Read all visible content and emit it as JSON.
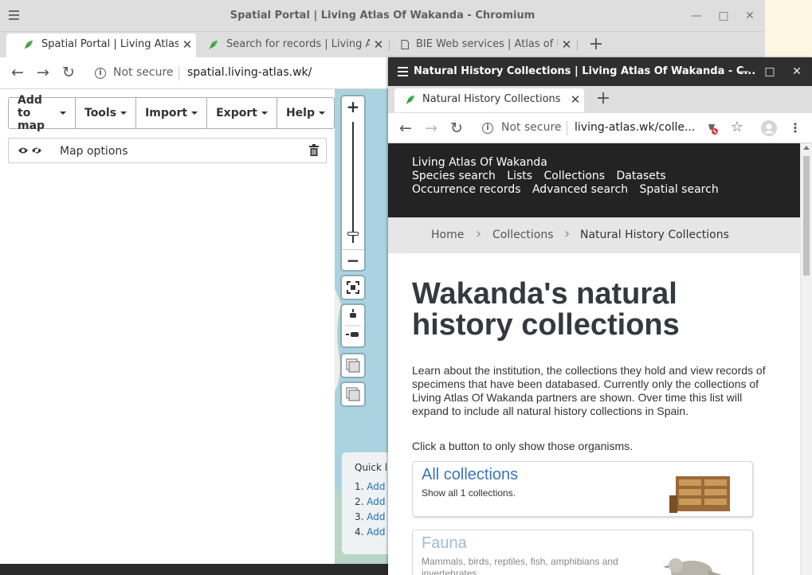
{
  "window1": {
    "title": "Spatial Portal | Living Atlas Of Wakanda - Chromium",
    "tabs": [
      {
        "label": "Spatial Portal | Living Atlas"
      },
      {
        "label": "Search for records | Living A"
      },
      {
        "label": "BIE Web services | Atlas of L"
      }
    ],
    "address": {
      "security": "Not secure",
      "url": "spatial.living-atlas.wk/"
    },
    "toolbar": {
      "add_to_map": "Add to map",
      "tools": "Tools",
      "import": "Import",
      "export": "Export",
      "help": "Help"
    },
    "map_options": "Map options",
    "quick_links": {
      "title": "Quick li",
      "items": [
        "1.",
        "2.",
        "3.",
        "4."
      ],
      "link_text": "Add"
    }
  },
  "window2": {
    "title": "Natural History Collections | Living Atlas Of Wakanda - C...",
    "tab": "Natural History Collections",
    "address": {
      "security": "Not secure",
      "url": "living-atlas.wk/colle..."
    },
    "site_nav": {
      "brand": "Living Atlas Of Wakanda",
      "row1": [
        "Species search",
        "Lists",
        "Collections",
        "Datasets"
      ],
      "row2": [
        "Occurrence records",
        "Advanced search",
        "Spatial search"
      ]
    },
    "breadcrumb": [
      "Home",
      "Collections",
      "Natural History Collections"
    ],
    "heading": "Wakanda's natural history collections",
    "intro": "Learn about the institution, the collections they hold and view records of specimens that have been databased. Currently only the collections of Living Atlas Of Wakanda partners are shown. Over time this list will expand to include all natural history collections in Spain.",
    "click_prompt": "Click a button to only show those organisms.",
    "cards": [
      {
        "title": "All collections",
        "desc": "Show all 1 collections."
      },
      {
        "title": "Fauna",
        "desc": "Mammals, birds, reptiles, fish, amphibians and invertebrates."
      }
    ]
  },
  "colors": {
    "accent": "#3976b8",
    "nav_bg": "#232323",
    "map_water": "#aad3df"
  }
}
